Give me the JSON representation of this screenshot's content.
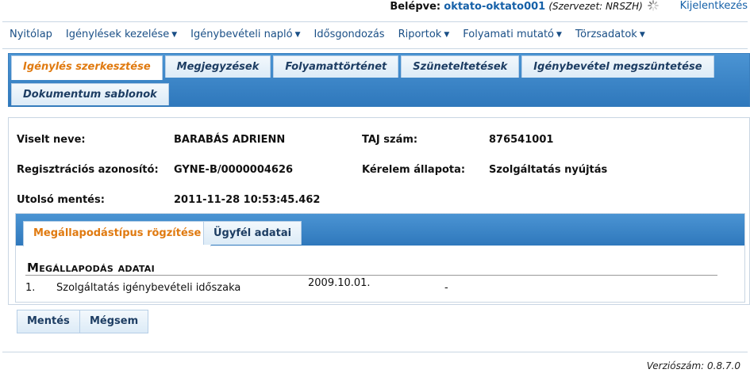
{
  "header": {
    "login_label": "Belépve:",
    "user": "oktato-oktato001",
    "org": "(Szervezet: NRSZH)",
    "logout": "Kijelentkezés"
  },
  "menu": [
    {
      "label": "Nyitólap",
      "caret": false
    },
    {
      "label": "Igénylések kezelése",
      "caret": true
    },
    {
      "label": "Igénybevételi napló",
      "caret": true
    },
    {
      "label": "Idősgondozás",
      "caret": false
    },
    {
      "label": "Riportok",
      "caret": true
    },
    {
      "label": "Folyamati mutató",
      "caret": true
    },
    {
      "label": "Törzsadatok",
      "caret": true
    }
  ],
  "tabs": {
    "t1": "Igénylés szerkesztése",
    "t2": "Megjegyzések",
    "t3": "Folyamattörténet",
    "t4": "Szüneteltetések",
    "t5": "Igénybevétel megszüntetése",
    "t6": "Dokumentum sablonok"
  },
  "record": {
    "name_label": "Viselt neve:",
    "name_value": "BARABÁS ADRIENN",
    "taj_label": "TAJ szám:",
    "taj_value": "876541001",
    "reg_label": "Regisztrációs azonosító:",
    "reg_value": "GYNE-B/0000004626",
    "status_label": "Kérelem állapota:",
    "status_value": "Szolgáltatás nyújtás",
    "saved_label": "Utolsó mentés:",
    "saved_value": "2011-11-28 10:53:45.462"
  },
  "inner_tabs": {
    "a": "Megállapodástípus rögzítése",
    "b": "Ügyfél adatai"
  },
  "agreement": {
    "title": "Megállapodás adatai",
    "row_num": "1.",
    "row_label": "Szolgáltatás igénybevételi időszaka",
    "row_from": "2009.10.01.",
    "row_to": "-"
  },
  "buttons": {
    "save": "Mentés",
    "cancel": "Mégsem"
  },
  "version": "Verziószám: 0.8.7.0",
  "colors": {
    "accent": "#e07a10",
    "link": "#1560a8",
    "tabbar": "#3f88c8"
  }
}
